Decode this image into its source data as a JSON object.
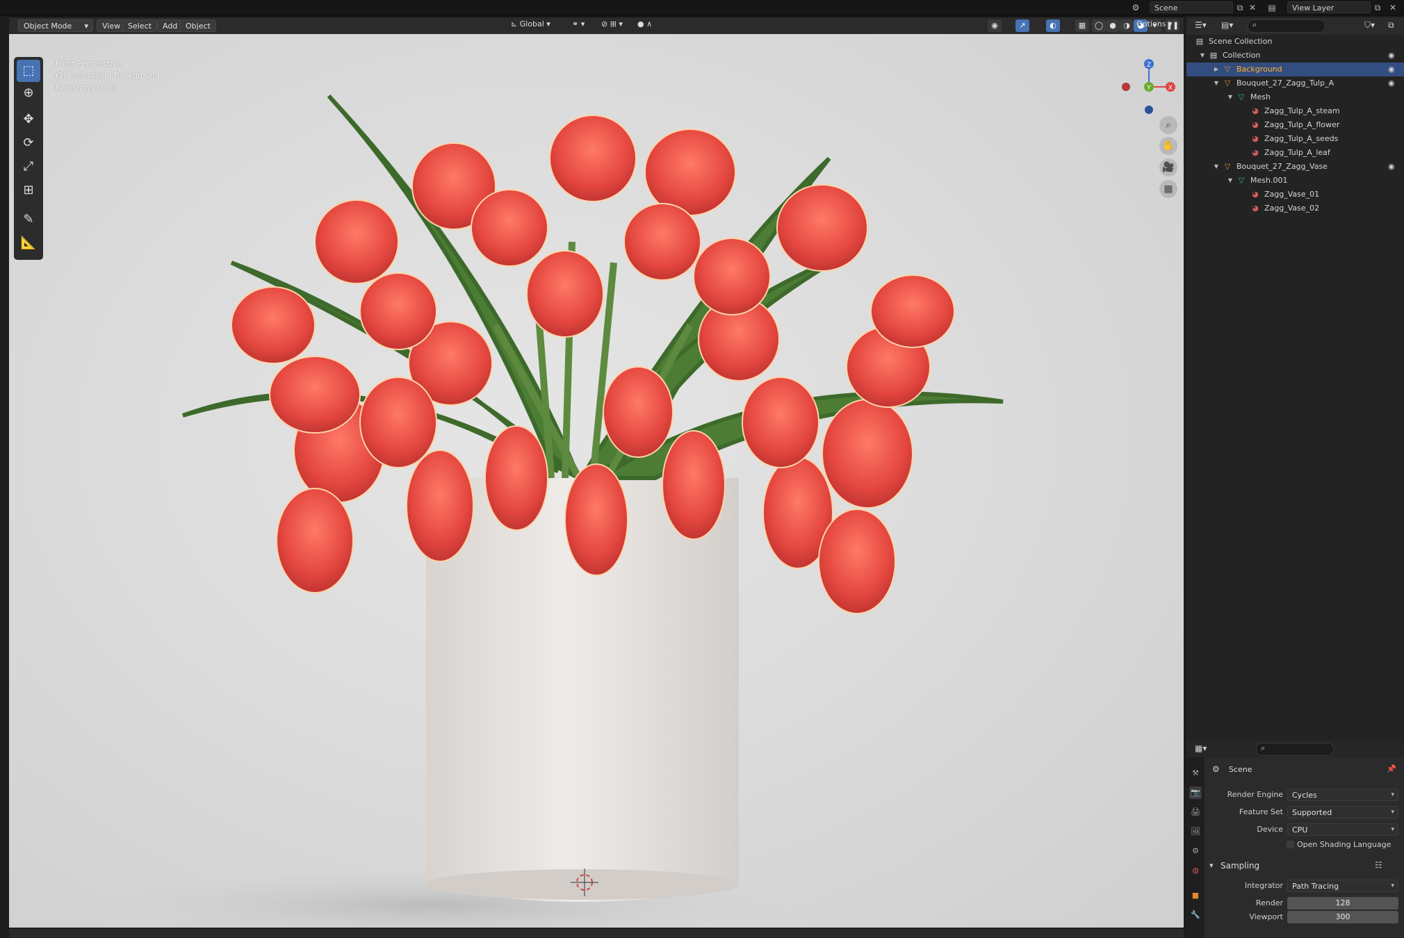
{
  "topbar": {
    "scene_label": "Scene",
    "view_layer_label": "View Layer"
  },
  "viewport_header": {
    "mode": "Object Mode",
    "menus": [
      "View",
      "Select",
      "Add",
      "Object"
    ],
    "orientation": "Global",
    "options_label": "Options"
  },
  "viewport_overlay": {
    "view_name": "Front Perspective",
    "collection_info": "(1) Collection | Background",
    "status": "Rendering Done"
  },
  "gizmo": {
    "z": "Z",
    "y": "Y",
    "x": "X"
  },
  "outliner": {
    "rows": [
      {
        "label": "Scene Collection",
        "depth": 0,
        "arrow": "",
        "icon": "scene-collection-icon",
        "selected": false,
        "eye": false
      },
      {
        "label": "Collection",
        "depth": 1,
        "arrow": "▼",
        "icon": "collection-icon",
        "selected": false,
        "eye": true
      },
      {
        "label": "Background",
        "depth": 2,
        "arrow": "▶",
        "icon": "object-icon",
        "selected": true,
        "eye": true
      },
      {
        "label": "Bouquet_27_Zagg_Tulp_A",
        "depth": 2,
        "arrow": "▼",
        "icon": "object-icon",
        "selected": false,
        "eye": true
      },
      {
        "label": "Mesh",
        "depth": 3,
        "arrow": "▼",
        "icon": "mesh-icon",
        "selected": false,
        "eye": false
      },
      {
        "label": "Zagg_Tulp_A_steam",
        "depth": 4,
        "arrow": "",
        "icon": "material-icon",
        "selected": false,
        "eye": false
      },
      {
        "label": "Zagg_Tulp_A_flower",
        "depth": 4,
        "arrow": "",
        "icon": "material-icon",
        "selected": false,
        "eye": false
      },
      {
        "label": "Zagg_Tulp_A_seeds",
        "depth": 4,
        "arrow": "",
        "icon": "material-icon",
        "selected": false,
        "eye": false
      },
      {
        "label": "Zagg_Tulp_A_leaf",
        "depth": 4,
        "arrow": "",
        "icon": "material-icon",
        "selected": false,
        "eye": false
      },
      {
        "label": "Bouquet_27_Zagg_Vase",
        "depth": 2,
        "arrow": "▼",
        "icon": "object-icon",
        "selected": false,
        "eye": true
      },
      {
        "label": "Mesh.001",
        "depth": 3,
        "arrow": "▼",
        "icon": "mesh-icon",
        "selected": false,
        "eye": false
      },
      {
        "label": "Zagg_Vase_01",
        "depth": 4,
        "arrow": "",
        "icon": "material-icon",
        "selected": false,
        "eye": false
      },
      {
        "label": "Zagg_Vase_02",
        "depth": 4,
        "arrow": "",
        "icon": "material-icon",
        "selected": false,
        "eye": false
      }
    ]
  },
  "properties": {
    "context_title": "Scene",
    "render_engine_label": "Render Engine",
    "render_engine": "Cycles",
    "feature_set_label": "Feature Set",
    "feature_set": "Supported",
    "device_label": "Device",
    "device": "CPU",
    "osl_label": "Open Shading Language",
    "sampling_label": "Sampling",
    "integrator_label": "Integrator",
    "integrator": "Path Tracing",
    "render_samples_label": "Render",
    "render_samples": "128",
    "viewport_samples_label": "Viewport",
    "viewport_samples": "300"
  },
  "colors": {
    "accent": "#4772b3",
    "selected_row": "#334d80",
    "selected_text": "#ffaf29",
    "tulip": "#e8504a",
    "vase": "#e9e5e2"
  }
}
